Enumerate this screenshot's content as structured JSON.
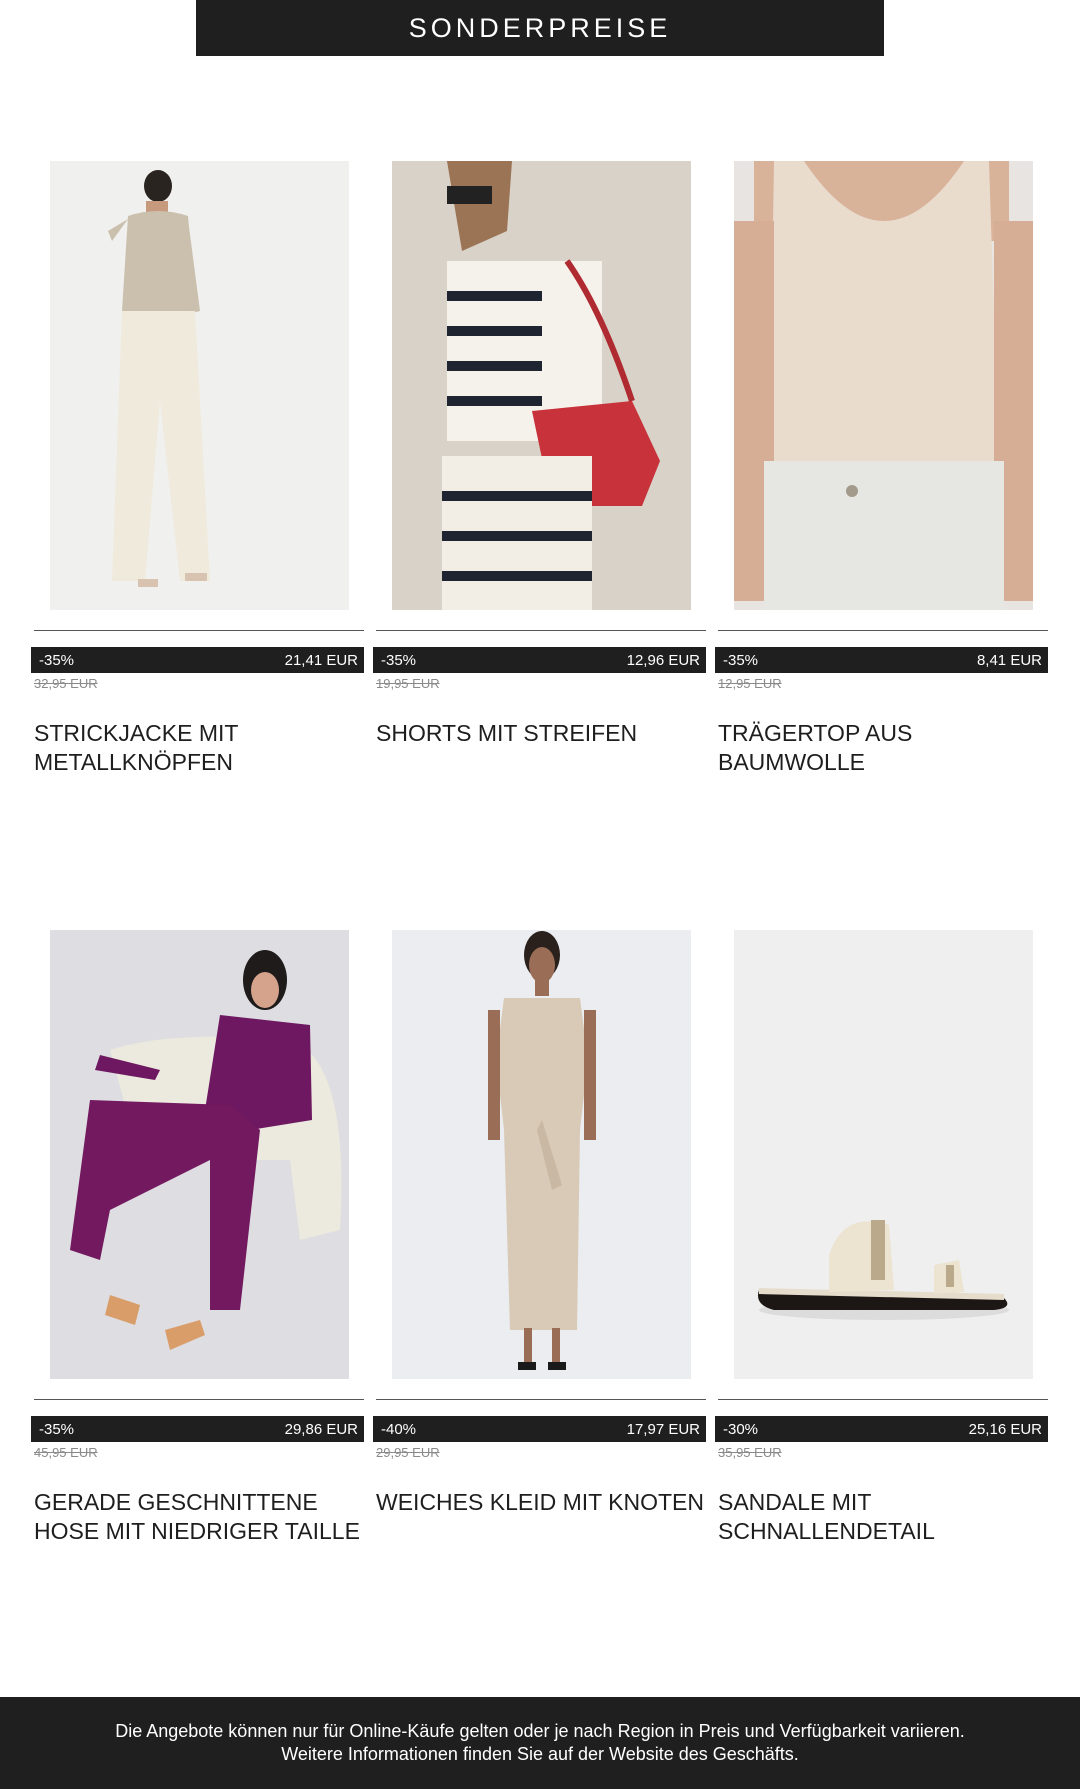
{
  "header": {
    "title": "SONDERPREISE"
  },
  "products": [
    {
      "discount": "-35%",
      "price": "21,41 EUR",
      "old_price": "32,95 EUR",
      "name": "STRICKJACKE MIT METALLKNÖPFEN"
    },
    {
      "discount": "-35%",
      "price": "12,96 EUR",
      "old_price": "19,95 EUR",
      "name": "SHORTS MIT STREIFEN"
    },
    {
      "discount": "-35%",
      "price": "8,41 EUR",
      "old_price": "12,95 EUR",
      "name": "TRÄGERTOP AUS BAUMWOLLE"
    },
    {
      "discount": "-35%",
      "price": "29,86 EUR",
      "old_price": "45,95 EUR",
      "name": "GERADE GESCHNITTENE HOSE MIT NIEDRIGER TAILLE"
    },
    {
      "discount": "-40%",
      "price": "17,97 EUR",
      "old_price": "29,95 EUR",
      "name": "WEICHES KLEID MIT KNOTEN"
    },
    {
      "discount": "-30%",
      "price": "25,16 EUR",
      "old_price": "35,95 EUR",
      "name": "SANDALE MIT SCHNALLENDETAIL"
    }
  ],
  "footer": {
    "line1": "Die Angebote können nur für Online-Käufe gelten oder je nach Region in Preis und Verfügbarkeit variieren.",
    "line2": "Weitere Informationen finden Sie auf der Website des Geschäfts."
  }
}
